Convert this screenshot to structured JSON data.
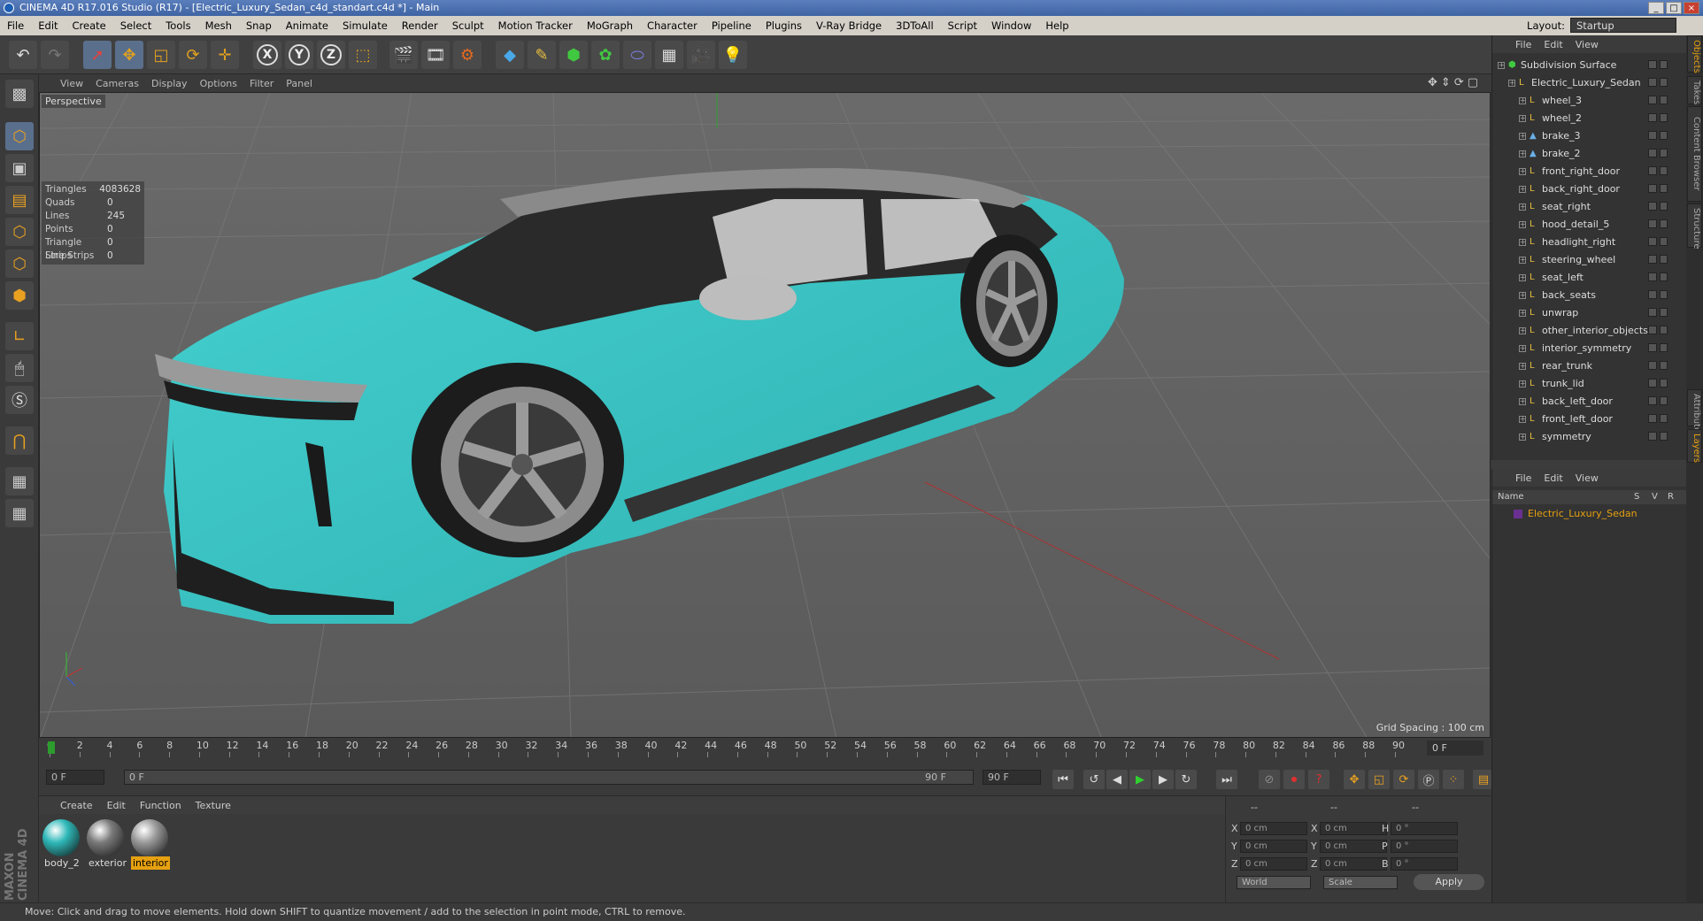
{
  "window": {
    "title": "CINEMA 4D R17.016 Studio (R17) - [Electric_Luxury_Sedan_c4d_standart.c4d *] - Main"
  },
  "menubar": {
    "items": [
      "File",
      "Edit",
      "Create",
      "Select",
      "Tools",
      "Mesh",
      "Snap",
      "Animate",
      "Simulate",
      "Render",
      "Sculpt",
      "Motion Tracker",
      "MoGraph",
      "Character",
      "Pipeline",
      "Plugins",
      "V-Ray Bridge",
      "3DToAll",
      "Script",
      "Window",
      "Help"
    ],
    "layout_label": "Layout:",
    "layout_value": "Startup"
  },
  "viewport": {
    "menu": [
      "View",
      "Cameras",
      "Display",
      "Options",
      "Filter",
      "Panel"
    ],
    "label": "Perspective",
    "grid_spacing": "Grid Spacing : 100 cm",
    "stats": [
      {
        "k": "Triangles",
        "v": "4083628"
      },
      {
        "k": "Quads",
        "v": "0"
      },
      {
        "k": "Lines",
        "v": "245"
      },
      {
        "k": "Points",
        "v": "0"
      },
      {
        "k": "Triangle Strips",
        "v": "0"
      },
      {
        "k": "Line Strips",
        "v": "0"
      }
    ],
    "colors": {
      "body": "#3ec6c6",
      "background": "#5d5d5d"
    }
  },
  "timeline": {
    "ticks": [
      "0",
      "2",
      "4",
      "6",
      "8",
      "10",
      "12",
      "14",
      "16",
      "18",
      "20",
      "22",
      "24",
      "26",
      "28",
      "30",
      "32",
      "34",
      "36",
      "38",
      "40",
      "42",
      "44",
      "46",
      "48",
      "50",
      "52",
      "54",
      "56",
      "58",
      "60",
      "62",
      "64",
      "66",
      "68",
      "70",
      "72",
      "74",
      "76",
      "78",
      "80",
      "82",
      "84",
      "86",
      "88",
      "90"
    ],
    "end_frame": "0 F"
  },
  "transport": {
    "start": "0 F",
    "slider_start": "0 F",
    "slider_end": "90 F",
    "end": "90 F"
  },
  "materials": {
    "menu": [
      "Create",
      "Edit",
      "Function",
      "Texture"
    ],
    "items": [
      {
        "name": "body_2",
        "color": "#2fb8b8"
      },
      {
        "name": "exterior",
        "color": "#7a7a7a"
      },
      {
        "name": "interior",
        "color": "#9a9a9a"
      }
    ]
  },
  "coords": {
    "labels_left": [
      "X",
      "Y",
      "Z"
    ],
    "labels_mid": [
      "X",
      "Y",
      "Z"
    ],
    "labels_right": [
      "H",
      "P",
      "B"
    ],
    "pos": [
      "0 cm",
      "0 cm",
      "0 cm"
    ],
    "size": [
      "0 cm",
      "0 cm",
      "0 cm"
    ],
    "rot": [
      "0 °",
      "0 °",
      "0 °"
    ],
    "header": [
      "--",
      "--",
      "--"
    ],
    "mode1": "World",
    "mode2": "Scale",
    "apply": "Apply"
  },
  "status": "Move: Click and drag to move elements. Hold down SHIFT to quantize movement / add to the selection in point mode, CTRL to remove.",
  "logo_text": "MAXON CINEMA 4D",
  "object_manager": {
    "menu": [
      "File",
      "Edit",
      "View"
    ],
    "items": [
      {
        "name": "Subdivision Surface",
        "depth": 0
      },
      {
        "name": "Electric_Luxury_Sedan",
        "depth": 1
      },
      {
        "name": "wheel_3",
        "depth": 2
      },
      {
        "name": "wheel_2",
        "depth": 2
      },
      {
        "name": "brake_3",
        "depth": 2
      },
      {
        "name": "brake_2",
        "depth": 2
      },
      {
        "name": "front_right_door",
        "depth": 2
      },
      {
        "name": "back_right_door",
        "depth": 2
      },
      {
        "name": "seat_right",
        "depth": 2
      },
      {
        "name": "hood_detail_5",
        "depth": 2
      },
      {
        "name": "headlight_right",
        "depth": 2
      },
      {
        "name": "steering_wheel",
        "depth": 2
      },
      {
        "name": "seat_left",
        "depth": 2
      },
      {
        "name": "back_seats",
        "depth": 2
      },
      {
        "name": "unwrap",
        "depth": 2
      },
      {
        "name": "other_interior_objects",
        "depth": 2
      },
      {
        "name": "interior_symmetry",
        "depth": 2
      },
      {
        "name": "rear_trunk",
        "depth": 2
      },
      {
        "name": "trunk_lid",
        "depth": 2
      },
      {
        "name": "back_left_door",
        "depth": 2
      },
      {
        "name": "front_left_door",
        "depth": 2
      },
      {
        "name": "symmetry",
        "depth": 2
      }
    ]
  },
  "layer_manager": {
    "menu": [
      "File",
      "Edit",
      "View"
    ],
    "header": {
      "name": "Name",
      "s": "S",
      "v": "V",
      "r": "R"
    },
    "layer": "Electric_Luxury_Sedan"
  },
  "side_tabs": [
    "Objects",
    "Takes",
    "Content Browser",
    "Structure",
    "Attributes",
    "Layers"
  ]
}
